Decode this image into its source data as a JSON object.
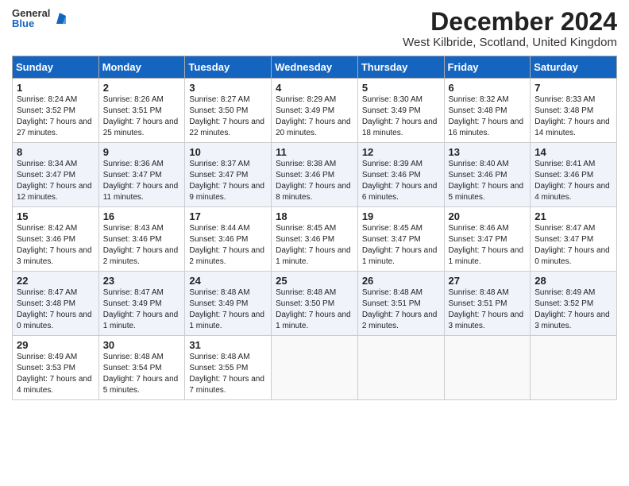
{
  "header": {
    "logo_general": "General",
    "logo_blue": "Blue",
    "month_title": "December 2024",
    "subtitle": "West Kilbride, Scotland, United Kingdom"
  },
  "days_of_week": [
    "Sunday",
    "Monday",
    "Tuesday",
    "Wednesday",
    "Thursday",
    "Friday",
    "Saturday"
  ],
  "weeks": [
    [
      {
        "day": "1",
        "sunrise": "8:24 AM",
        "sunset": "3:52 PM",
        "daylight": "7 hours and 27 minutes."
      },
      {
        "day": "2",
        "sunrise": "8:26 AM",
        "sunset": "3:51 PM",
        "daylight": "7 hours and 25 minutes."
      },
      {
        "day": "3",
        "sunrise": "8:27 AM",
        "sunset": "3:50 PM",
        "daylight": "7 hours and 22 minutes."
      },
      {
        "day": "4",
        "sunrise": "8:29 AM",
        "sunset": "3:49 PM",
        "daylight": "7 hours and 20 minutes."
      },
      {
        "day": "5",
        "sunrise": "8:30 AM",
        "sunset": "3:49 PM",
        "daylight": "7 hours and 18 minutes."
      },
      {
        "day": "6",
        "sunrise": "8:32 AM",
        "sunset": "3:48 PM",
        "daylight": "7 hours and 16 minutes."
      },
      {
        "day": "7",
        "sunrise": "8:33 AM",
        "sunset": "3:48 PM",
        "daylight": "7 hours and 14 minutes."
      }
    ],
    [
      {
        "day": "8",
        "sunrise": "8:34 AM",
        "sunset": "3:47 PM",
        "daylight": "7 hours and 12 minutes."
      },
      {
        "day": "9",
        "sunrise": "8:36 AM",
        "sunset": "3:47 PM",
        "daylight": "7 hours and 11 minutes."
      },
      {
        "day": "10",
        "sunrise": "8:37 AM",
        "sunset": "3:47 PM",
        "daylight": "7 hours and 9 minutes."
      },
      {
        "day": "11",
        "sunrise": "8:38 AM",
        "sunset": "3:46 PM",
        "daylight": "7 hours and 8 minutes."
      },
      {
        "day": "12",
        "sunrise": "8:39 AM",
        "sunset": "3:46 PM",
        "daylight": "7 hours and 6 minutes."
      },
      {
        "day": "13",
        "sunrise": "8:40 AM",
        "sunset": "3:46 PM",
        "daylight": "7 hours and 5 minutes."
      },
      {
        "day": "14",
        "sunrise": "8:41 AM",
        "sunset": "3:46 PM",
        "daylight": "7 hours and 4 minutes."
      }
    ],
    [
      {
        "day": "15",
        "sunrise": "8:42 AM",
        "sunset": "3:46 PM",
        "daylight": "7 hours and 3 minutes."
      },
      {
        "day": "16",
        "sunrise": "8:43 AM",
        "sunset": "3:46 PM",
        "daylight": "7 hours and 2 minutes."
      },
      {
        "day": "17",
        "sunrise": "8:44 AM",
        "sunset": "3:46 PM",
        "daylight": "7 hours and 2 minutes."
      },
      {
        "day": "18",
        "sunrise": "8:45 AM",
        "sunset": "3:46 PM",
        "daylight": "7 hours and 1 minute."
      },
      {
        "day": "19",
        "sunrise": "8:45 AM",
        "sunset": "3:47 PM",
        "daylight": "7 hours and 1 minute."
      },
      {
        "day": "20",
        "sunrise": "8:46 AM",
        "sunset": "3:47 PM",
        "daylight": "7 hours and 1 minute."
      },
      {
        "day": "21",
        "sunrise": "8:47 AM",
        "sunset": "3:47 PM",
        "daylight": "7 hours and 0 minutes."
      }
    ],
    [
      {
        "day": "22",
        "sunrise": "8:47 AM",
        "sunset": "3:48 PM",
        "daylight": "7 hours and 0 minutes."
      },
      {
        "day": "23",
        "sunrise": "8:47 AM",
        "sunset": "3:49 PM",
        "daylight": "7 hours and 1 minute."
      },
      {
        "day": "24",
        "sunrise": "8:48 AM",
        "sunset": "3:49 PM",
        "daylight": "7 hours and 1 minute."
      },
      {
        "day": "25",
        "sunrise": "8:48 AM",
        "sunset": "3:50 PM",
        "daylight": "7 hours and 1 minute."
      },
      {
        "day": "26",
        "sunrise": "8:48 AM",
        "sunset": "3:51 PM",
        "daylight": "7 hours and 2 minutes."
      },
      {
        "day": "27",
        "sunrise": "8:48 AM",
        "sunset": "3:51 PM",
        "daylight": "7 hours and 3 minutes."
      },
      {
        "day": "28",
        "sunrise": "8:49 AM",
        "sunset": "3:52 PM",
        "daylight": "7 hours and 3 minutes."
      }
    ],
    [
      {
        "day": "29",
        "sunrise": "8:49 AM",
        "sunset": "3:53 PM",
        "daylight": "7 hours and 4 minutes."
      },
      {
        "day": "30",
        "sunrise": "8:48 AM",
        "sunset": "3:54 PM",
        "daylight": "7 hours and 5 minutes."
      },
      {
        "day": "31",
        "sunrise": "8:48 AM",
        "sunset": "3:55 PM",
        "daylight": "7 hours and 7 minutes."
      },
      null,
      null,
      null,
      null
    ]
  ]
}
